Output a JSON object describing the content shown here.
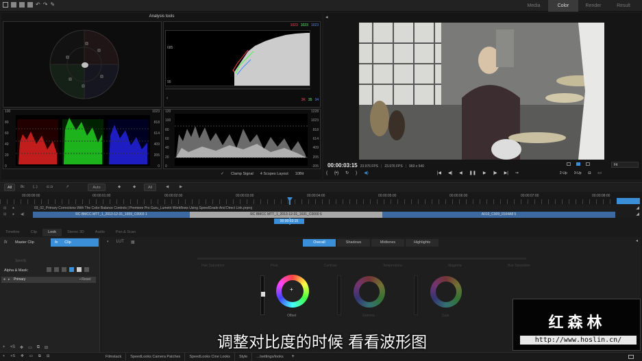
{
  "top_tabs": [
    "Media",
    "Color",
    "Render",
    "Result"
  ],
  "scope_title": "Analysis tools",
  "histogram": {
    "top": [
      "1023",
      "1023",
      "1023"
    ],
    "bottom": [
      "3K",
      "35",
      "34"
    ],
    "left_marks": [
      "685",
      "95"
    ],
    "top_colors": [
      "#ff5060",
      "#60ff70",
      "#6090ff"
    ]
  },
  "parade": {
    "left": [
      "100",
      "80",
      "60",
      "40",
      "20",
      "0"
    ],
    "right": [
      "1023",
      "818",
      "614",
      "409",
      "205",
      "0"
    ]
  },
  "luma": {
    "left": [
      "120",
      "100",
      "80",
      "60",
      "40",
      "20",
      "0"
    ],
    "right": [
      "1228",
      "1023",
      "818",
      "614",
      "409",
      "205",
      "-205"
    ]
  },
  "scope_controls": {
    "clamp": "Clamp Signal",
    "layout": "4 Scopes Layout",
    "bit": "10Bit"
  },
  "viewer": {
    "timecode": "00:00:03:15",
    "fps1": "23.976 FPS",
    "fps2": "23.976 FPS",
    "res": "960 x 540",
    "fit": "Fit",
    "up2": "2-Up",
    "up3": "3-Up"
  },
  "timeline_bar": {
    "all": "All",
    "auto": "Auto",
    "all2": "All",
    "times": [
      "00:00:00:00",
      "00:00:01:00",
      "00:00:02:00",
      "00:00:03:00",
      "00:00:04:00",
      "00:00:05:00",
      "00:00:06:00",
      "00:00:07:00",
      "00:00:08:00"
    ]
  },
  "project": "03_02_Primary Corrections With The Color Balance Controls | Premiere Pro Guru_Lumetri Workflows Using SpeedGrade And Direct Link.prproj",
  "clips": [
    "RC BMCC MTT_1_2013-12-31_1659_C0003 1",
    "RC BMCC MTT_1_2013-12-31_1631_C0000 6",
    "A010_C009_0104A8 5"
  ],
  "playhead_tc": "00:00:03:15",
  "bottom_tabs": [
    "Timeline",
    "Clip",
    "Look",
    "Stereo 3D",
    "Audio",
    "Pan & Scan"
  ],
  "look_panel": {
    "master": "Master Clip",
    "clip": "Clip",
    "specify": "Specify",
    "alpha_mask": "Alpha & Mask:",
    "primary": "Primary",
    "reset": "Reset"
  },
  "grade_tabs": [
    "Overall",
    "Shadows",
    "Midtones",
    "Highlights"
  ],
  "ranges": [
    "Hue Saturation",
    "Pivot",
    "Contrast",
    "Temperature",
    "Magenta",
    "Hue Saturation"
  ],
  "wheels": [
    "Offset",
    "Gamma",
    "Gain"
  ],
  "footer_tabs": [
    "Filmstack",
    "SpeedLooks Camera Patches",
    "SpeedLooks Cine Looks",
    "Style",
    ".../settings/looks"
  ],
  "subtitle": "调整对比度的时候 看看波形图",
  "watermark": {
    "title": "红森林",
    "url": "http://www.hoslin.cn/"
  }
}
